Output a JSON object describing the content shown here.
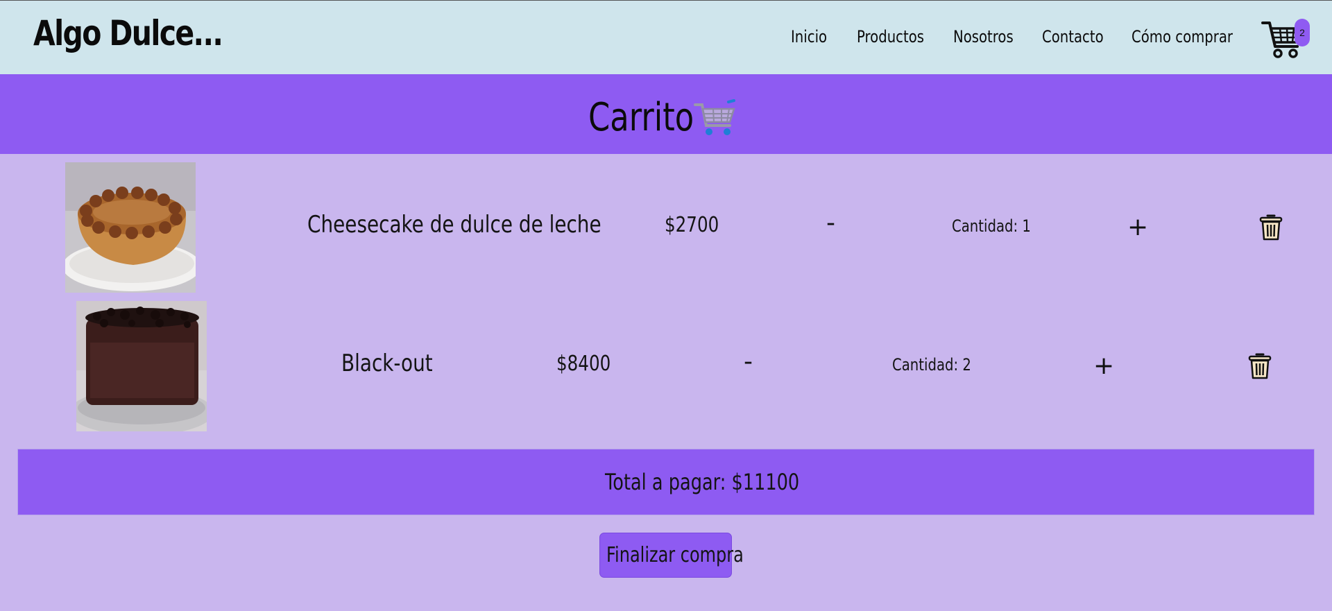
{
  "header": {
    "logo": "Algo Dulce...",
    "nav": [
      {
        "label": "Inicio"
      },
      {
        "label": "Productos"
      },
      {
        "label": "Nosotros"
      },
      {
        "label": "Contacto"
      },
      {
        "label": "Cómo comprar"
      }
    ],
    "cart_icon": "shopping-cart-icon",
    "cart_count": "2"
  },
  "page": {
    "title": "Carrito",
    "title_icon": "shopping-cart-emoji"
  },
  "cart": {
    "items": [
      {
        "name": "Cheesecake de dulce de leche",
        "price": "$2700",
        "minus_label": "-",
        "quantity_text": "Cantidad: 1",
        "plus_label": "+",
        "delete_icon": "trash-icon",
        "image": "cheesecake-photo"
      },
      {
        "name": "Black-out",
        "price": "$8400",
        "minus_label": "-",
        "quantity_text": "Cantidad: 2",
        "plus_label": "+",
        "delete_icon": "trash-icon",
        "image": "chocolate-cake-photo"
      }
    ],
    "total_text": "Total a pagar: $11100",
    "checkout_label": "Finalizar compra"
  },
  "colors": {
    "header_bg": "#cfe5ec",
    "accent_purple": "#8e5bf2",
    "body_bg": "#c9b6ee"
  }
}
